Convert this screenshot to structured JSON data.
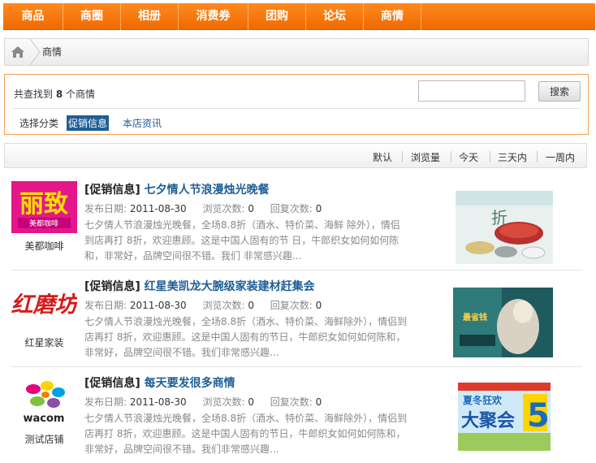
{
  "nav": [
    {
      "label": "商品",
      "w": 0
    },
    {
      "label": "商圈"
    },
    {
      "label": "相册"
    },
    {
      "label": "消费券"
    },
    {
      "label": "团购"
    },
    {
      "label": "论坛"
    },
    {
      "label": "商情"
    }
  ],
  "breadcrumb": {
    "current": "商情"
  },
  "search": {
    "found_prefix": "共查找到",
    "found_count": "8",
    "found_suffix": "个商情",
    "input_value": "",
    "button_label": "搜索",
    "category_label": "选择分类",
    "category_active": "促销信息",
    "category_other": "本店资讯"
  },
  "sort": [
    "默认",
    "浏览量",
    "今天",
    "三天内",
    "一周内"
  ],
  "items": [
    {
      "store": "美都咖啡",
      "category": "[促销信息]",
      "title": "七夕情人节浪漫烛光晚餐",
      "date_label": "发布日期:",
      "date": "2011-08-30",
      "views_label": "浏览次数:",
      "views": "0",
      "replies_label": "回复次数:",
      "replies": "0",
      "desc": "七夕情人节浪漫烛光晚餐，全场8.8折（酒水、特价菜、海鲜 除外），情侣到店再打 8折，欢迎惠顾。这是中国人固有的节 日，牛郎织女如何如何陈和，非常好，品牌空间很不错。我们 非常感兴趣..."
    },
    {
      "store": "红星家装",
      "category": "[促销信息]",
      "title": "红星美凯龙大腕级家装建材赶集会",
      "date_label": "发布日期:",
      "date": "2011-08-30",
      "views_label": "浏览次数:",
      "views": "0",
      "replies_label": "回复次数:",
      "replies": "0",
      "desc": "七夕情人节浪漫烛光晚餐，全场8.8折（酒水、特价菜、海鲜除外），情侣到店再打 8折，欢迎惠顾。这是中国人固有的节日，牛郎织女如何如何陈和，非常好，品牌空间很不错。我们非常感兴趣..."
    },
    {
      "store": "测试店铺",
      "category": "[促销信息]",
      "title": "每天要发很多商情",
      "date_label": "发布日期:",
      "date": "2011-08-30",
      "views_label": "浏览次数:",
      "views": "0",
      "replies_label": "回复次数:",
      "replies": "0",
      "desc": "七夕情人节浪漫烛光晚餐，全场8.8折（酒水、特价菜、海鲜除外），情侣到店再打 8折，欢迎惠顾。这是中国人固有的节日，牛郎织女如何如何陈和，非常好，品牌空间很不错。我们非常感兴趣..."
    }
  ],
  "logos": {
    "logo1_text": "丽致",
    "logo1_sub": "美都咖啡",
    "logo2_text": "红磨坊",
    "logo3_text": "wacom"
  },
  "pics": {
    "pic1_text": "折",
    "pic2_text": "最省钱",
    "pic3_big": "大聚会",
    "pic3_num": "5",
    "pic3_top": "夏冬狂欢"
  },
  "colors": {
    "nav_orange": "#f06a00",
    "link_blue": "#1f5e96",
    "border_orange": "#f2a055"
  }
}
